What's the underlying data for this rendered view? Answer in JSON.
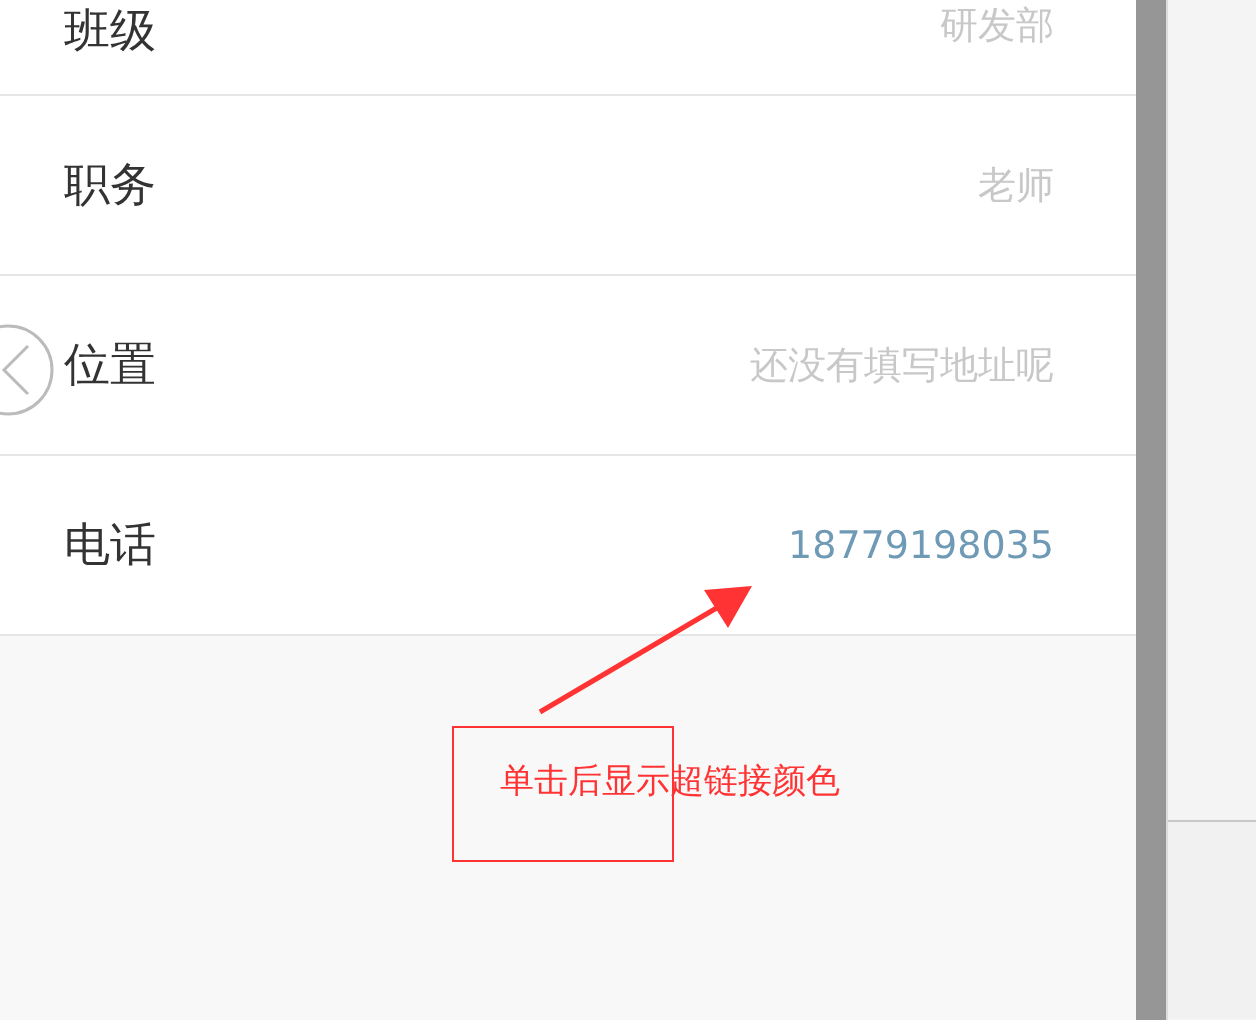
{
  "rows": [
    {
      "label": "班级",
      "value": "研发部",
      "kind": "plain"
    },
    {
      "label": "职务",
      "value": "老师",
      "kind": "plain"
    },
    {
      "label": "位置",
      "value": "还没有填写地址呢",
      "kind": "plain"
    },
    {
      "label": "电话",
      "value": "18779198035",
      "kind": "link"
    }
  ],
  "annotation": {
    "text": "单击后显示超链接颜色"
  }
}
